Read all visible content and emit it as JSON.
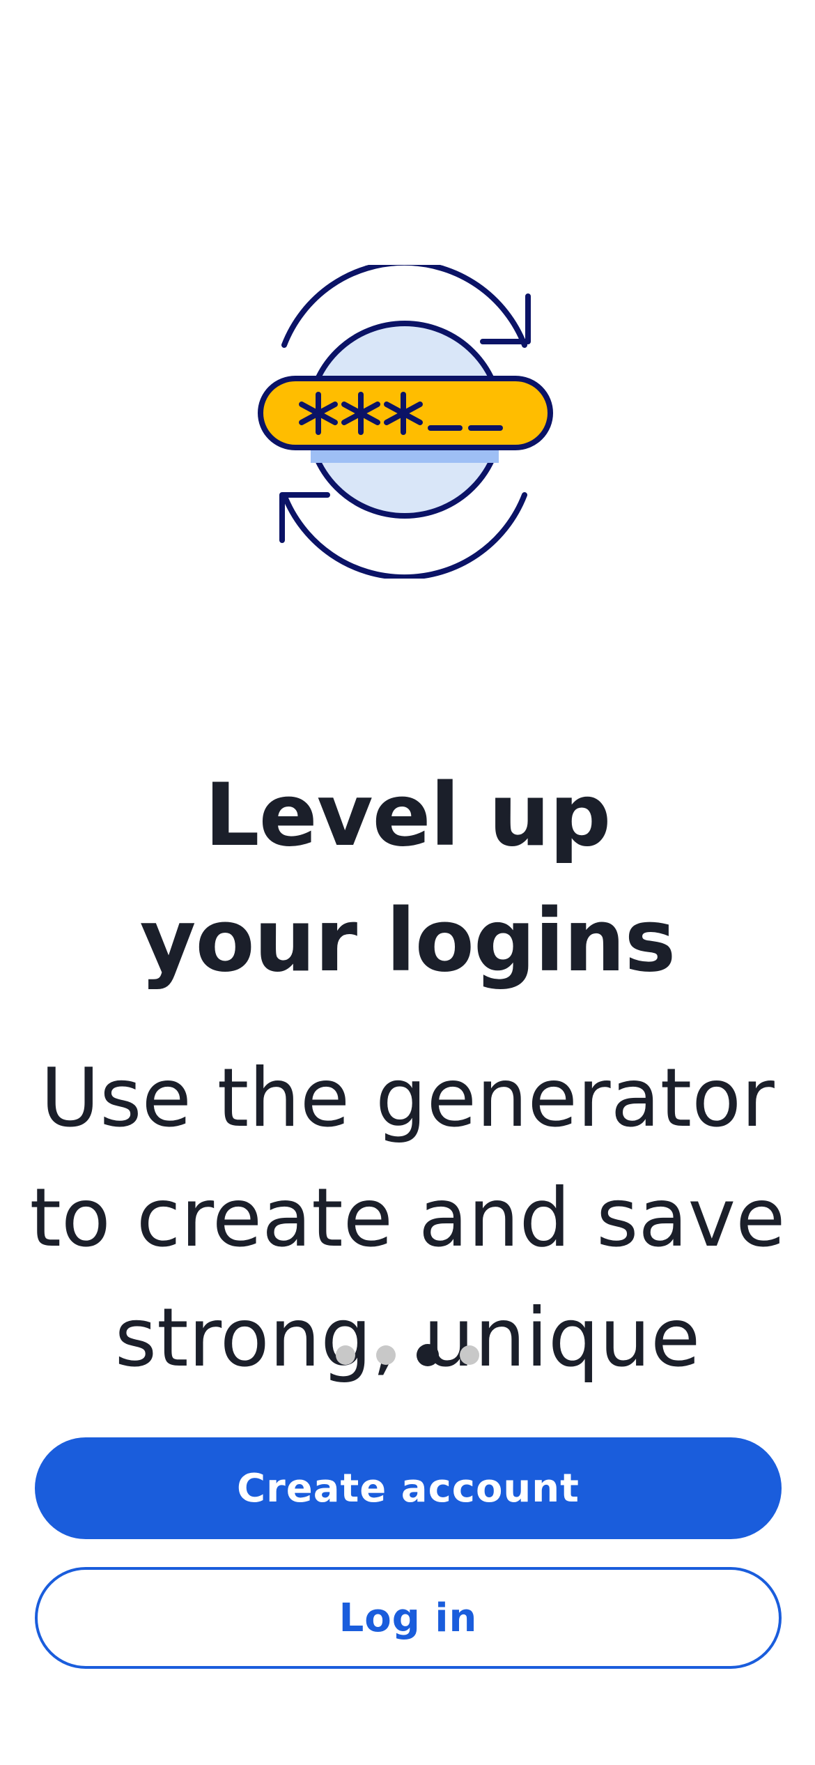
{
  "illustration": {
    "name": "password-refresh-illustration",
    "field_text": "***__",
    "colors": {
      "outline": "#0b1366",
      "circle_fill": "#d9e6f8",
      "circle_band": "#9ebff5",
      "field_fill": "#ffbd00"
    }
  },
  "headline": {
    "line1": "Level up",
    "line2": "your logins"
  },
  "body": {
    "text": "Use the generator to create and save strong, unique"
  },
  "pagination": {
    "total": 4,
    "active_index": 2
  },
  "buttons": {
    "create_account": "Create account",
    "log_in": "Log in"
  },
  "colors": {
    "accent": "#1a5ddc",
    "text": "#1b1f2a",
    "dot_inactive": "#c8c8c8",
    "background": "#ffffff"
  }
}
